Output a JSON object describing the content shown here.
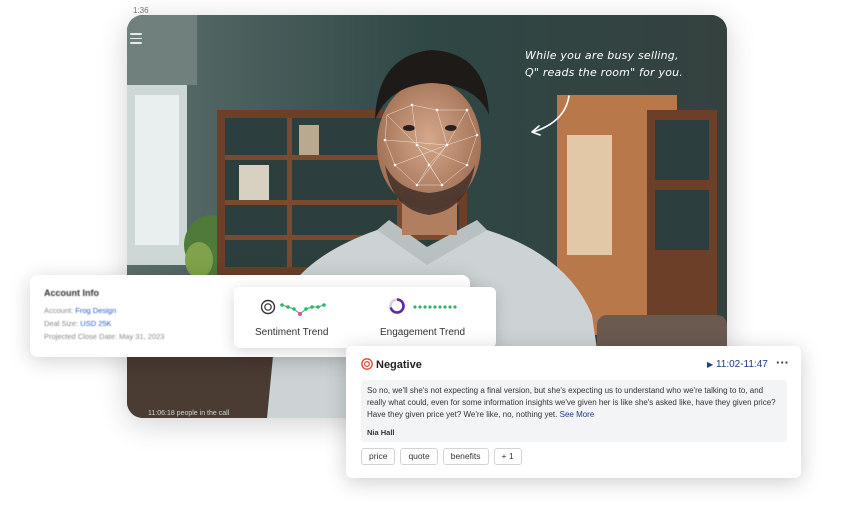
{
  "status_bar": {
    "time": "1:36"
  },
  "video": {
    "annotation_line1": "While you are busy selling,",
    "annotation_line2": "Q\" reads the room\" for you.",
    "caption": "11:06:18 people in the call"
  },
  "account_info": {
    "title": "Account Info",
    "account_label": "Account:",
    "account_value": "Frog Design",
    "deal_size_label": "Deal Size:",
    "deal_size_value": "USD 25K",
    "close_date": "Projected Close Date: May 31, 2023"
  },
  "trends": {
    "sentiment_label": "Sentiment Trend",
    "engagement_label": "Engagement Trend"
  },
  "negative_card": {
    "title": "Negative",
    "time_range": "11:02-11:47",
    "quote": "So no, we'll she's not expecting a final version, but she's expecting us to understand who we're talking to to, and really what could, even for some information insights we've given her is like she's asked like, have they given price? Have they given price yet? We're like, no, nothing yet.",
    "see_more": "See More",
    "speaker": "Nia Hall",
    "tags": [
      "price",
      "quote",
      "benefits",
      "+ 1"
    ]
  },
  "colors": {
    "accent_navy": "#1e3a8a",
    "negative_red": "#e0452b",
    "engagement_purple": "#5b2ca0",
    "sentiment_green": "#2fb36d",
    "sentiment_pink": "#e0508a"
  }
}
